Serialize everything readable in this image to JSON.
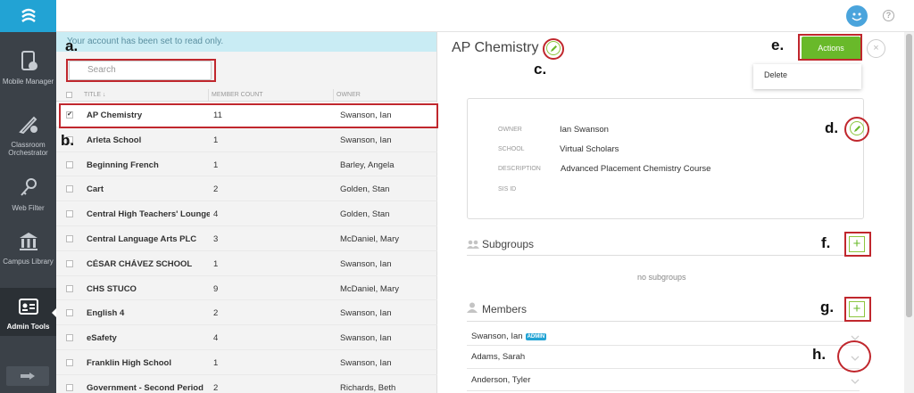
{
  "sidebar": {
    "items": [
      {
        "label": "Mobile Manager",
        "icon": "mobile-manager-icon"
      },
      {
        "label": "Classroom Orchestrator",
        "icon": "classroom-orchestrator-icon"
      },
      {
        "label": "Web Filter",
        "icon": "key-icon"
      },
      {
        "label": "Campus Library",
        "icon": "library-icon"
      },
      {
        "label": "Admin Tools",
        "icon": "admin-tools-icon"
      }
    ]
  },
  "banner": "Your account has been set to read only.",
  "search": {
    "placeholder": "Search"
  },
  "table": {
    "headers": {
      "title": "TITLE ↓",
      "members": "MEMBER COUNT",
      "owner": "OWNER"
    },
    "rows": [
      {
        "title": "AP Chemistry",
        "count": "11",
        "owner": "Swanson, Ian",
        "checked": "✔"
      },
      {
        "title": "Arleta School",
        "count": "1",
        "owner": "Swanson, Ian",
        "checked": ""
      },
      {
        "title": "Beginning French",
        "count": "1",
        "owner": "Barley, Angela",
        "checked": ""
      },
      {
        "title": "Cart",
        "count": "2",
        "owner": "Golden, Stan",
        "checked": ""
      },
      {
        "title": "Central High Teachers' Lounge",
        "count": "4",
        "owner": "Golden, Stan",
        "checked": ""
      },
      {
        "title": "Central Language Arts PLC",
        "count": "3",
        "owner": "McDaniel, Mary",
        "checked": ""
      },
      {
        "title": "CÉSAR CHÁVEZ SCHOOL",
        "count": "1",
        "owner": "Swanson, Ian",
        "checked": ""
      },
      {
        "title": "CHS STUCO",
        "count": "9",
        "owner": "McDaniel, Mary",
        "checked": ""
      },
      {
        "title": "English 4",
        "count": "2",
        "owner": "Swanson, Ian",
        "checked": ""
      },
      {
        "title": "eSafety",
        "count": "4",
        "owner": "Swanson, Ian",
        "checked": ""
      },
      {
        "title": "Franklin High School",
        "count": "1",
        "owner": "Swanson, Ian",
        "checked": ""
      },
      {
        "title": "Government - Second Period",
        "count": "2",
        "owner": "Richards, Beth",
        "checked": ""
      }
    ]
  },
  "detail": {
    "title": "AP Chemistry",
    "actions_label": "Actions",
    "close_label": "×",
    "menu": {
      "delete_label": "Delete"
    },
    "info": {
      "owner_label": "OWNER",
      "owner": "Ian Swanson",
      "school_label": "SCHOOL",
      "school": "Virtual Scholars",
      "description_label": "DESCRIPTION",
      "description": "Advanced Placement Chemistry Course",
      "sisid_label": "SIS ID"
    },
    "subgroups": {
      "title": "Subgroups",
      "empty": "no subgroups"
    },
    "members": {
      "title": "Members",
      "list": [
        {
          "name": "Swanson, Ian",
          "badge": "ADMIN"
        },
        {
          "name": "Adams, Sarah"
        },
        {
          "name": "Anderson, Tyler"
        }
      ]
    }
  },
  "annotations": [
    "a.",
    "b.",
    "c.",
    "d.",
    "e.",
    "f.",
    "g.",
    "h."
  ],
  "colors": {
    "accent": "#69b92a",
    "brand": "#22a3d4",
    "annotation": "#c0272d",
    "sidebar": "#3b4148"
  }
}
